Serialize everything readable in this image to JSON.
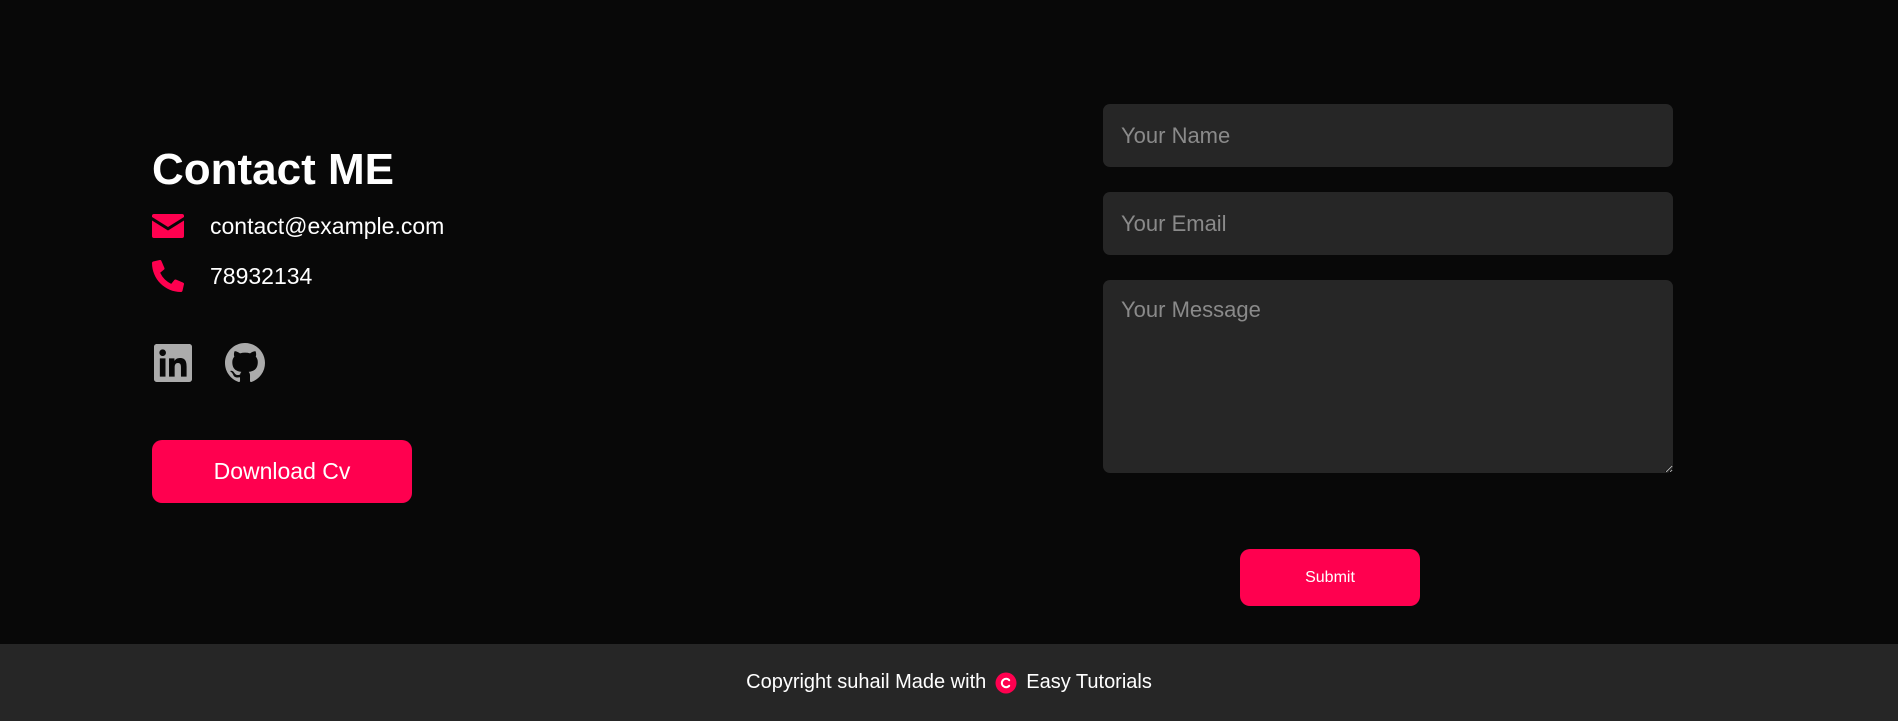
{
  "contact": {
    "title": "Contact ME",
    "email": "contact@example.com",
    "phone": "78932134",
    "download_label": "Download Cv",
    "socials": [
      {
        "icon": "linkedin-icon"
      },
      {
        "icon": "github-icon"
      }
    ]
  },
  "form": {
    "name_placeholder": "Your Name",
    "email_placeholder": "Your Email",
    "message_placeholder": "Your Message",
    "submit_label": "Submit"
  },
  "footer": {
    "text_before": "Copyright suhail Made with",
    "text_after": "Easy Tutorials",
    "icon": "copyright-icon"
  },
  "colors": {
    "accent": "#ff004f",
    "background": "#080808",
    "surface": "#262626",
    "icon_muted": "#ababab"
  }
}
